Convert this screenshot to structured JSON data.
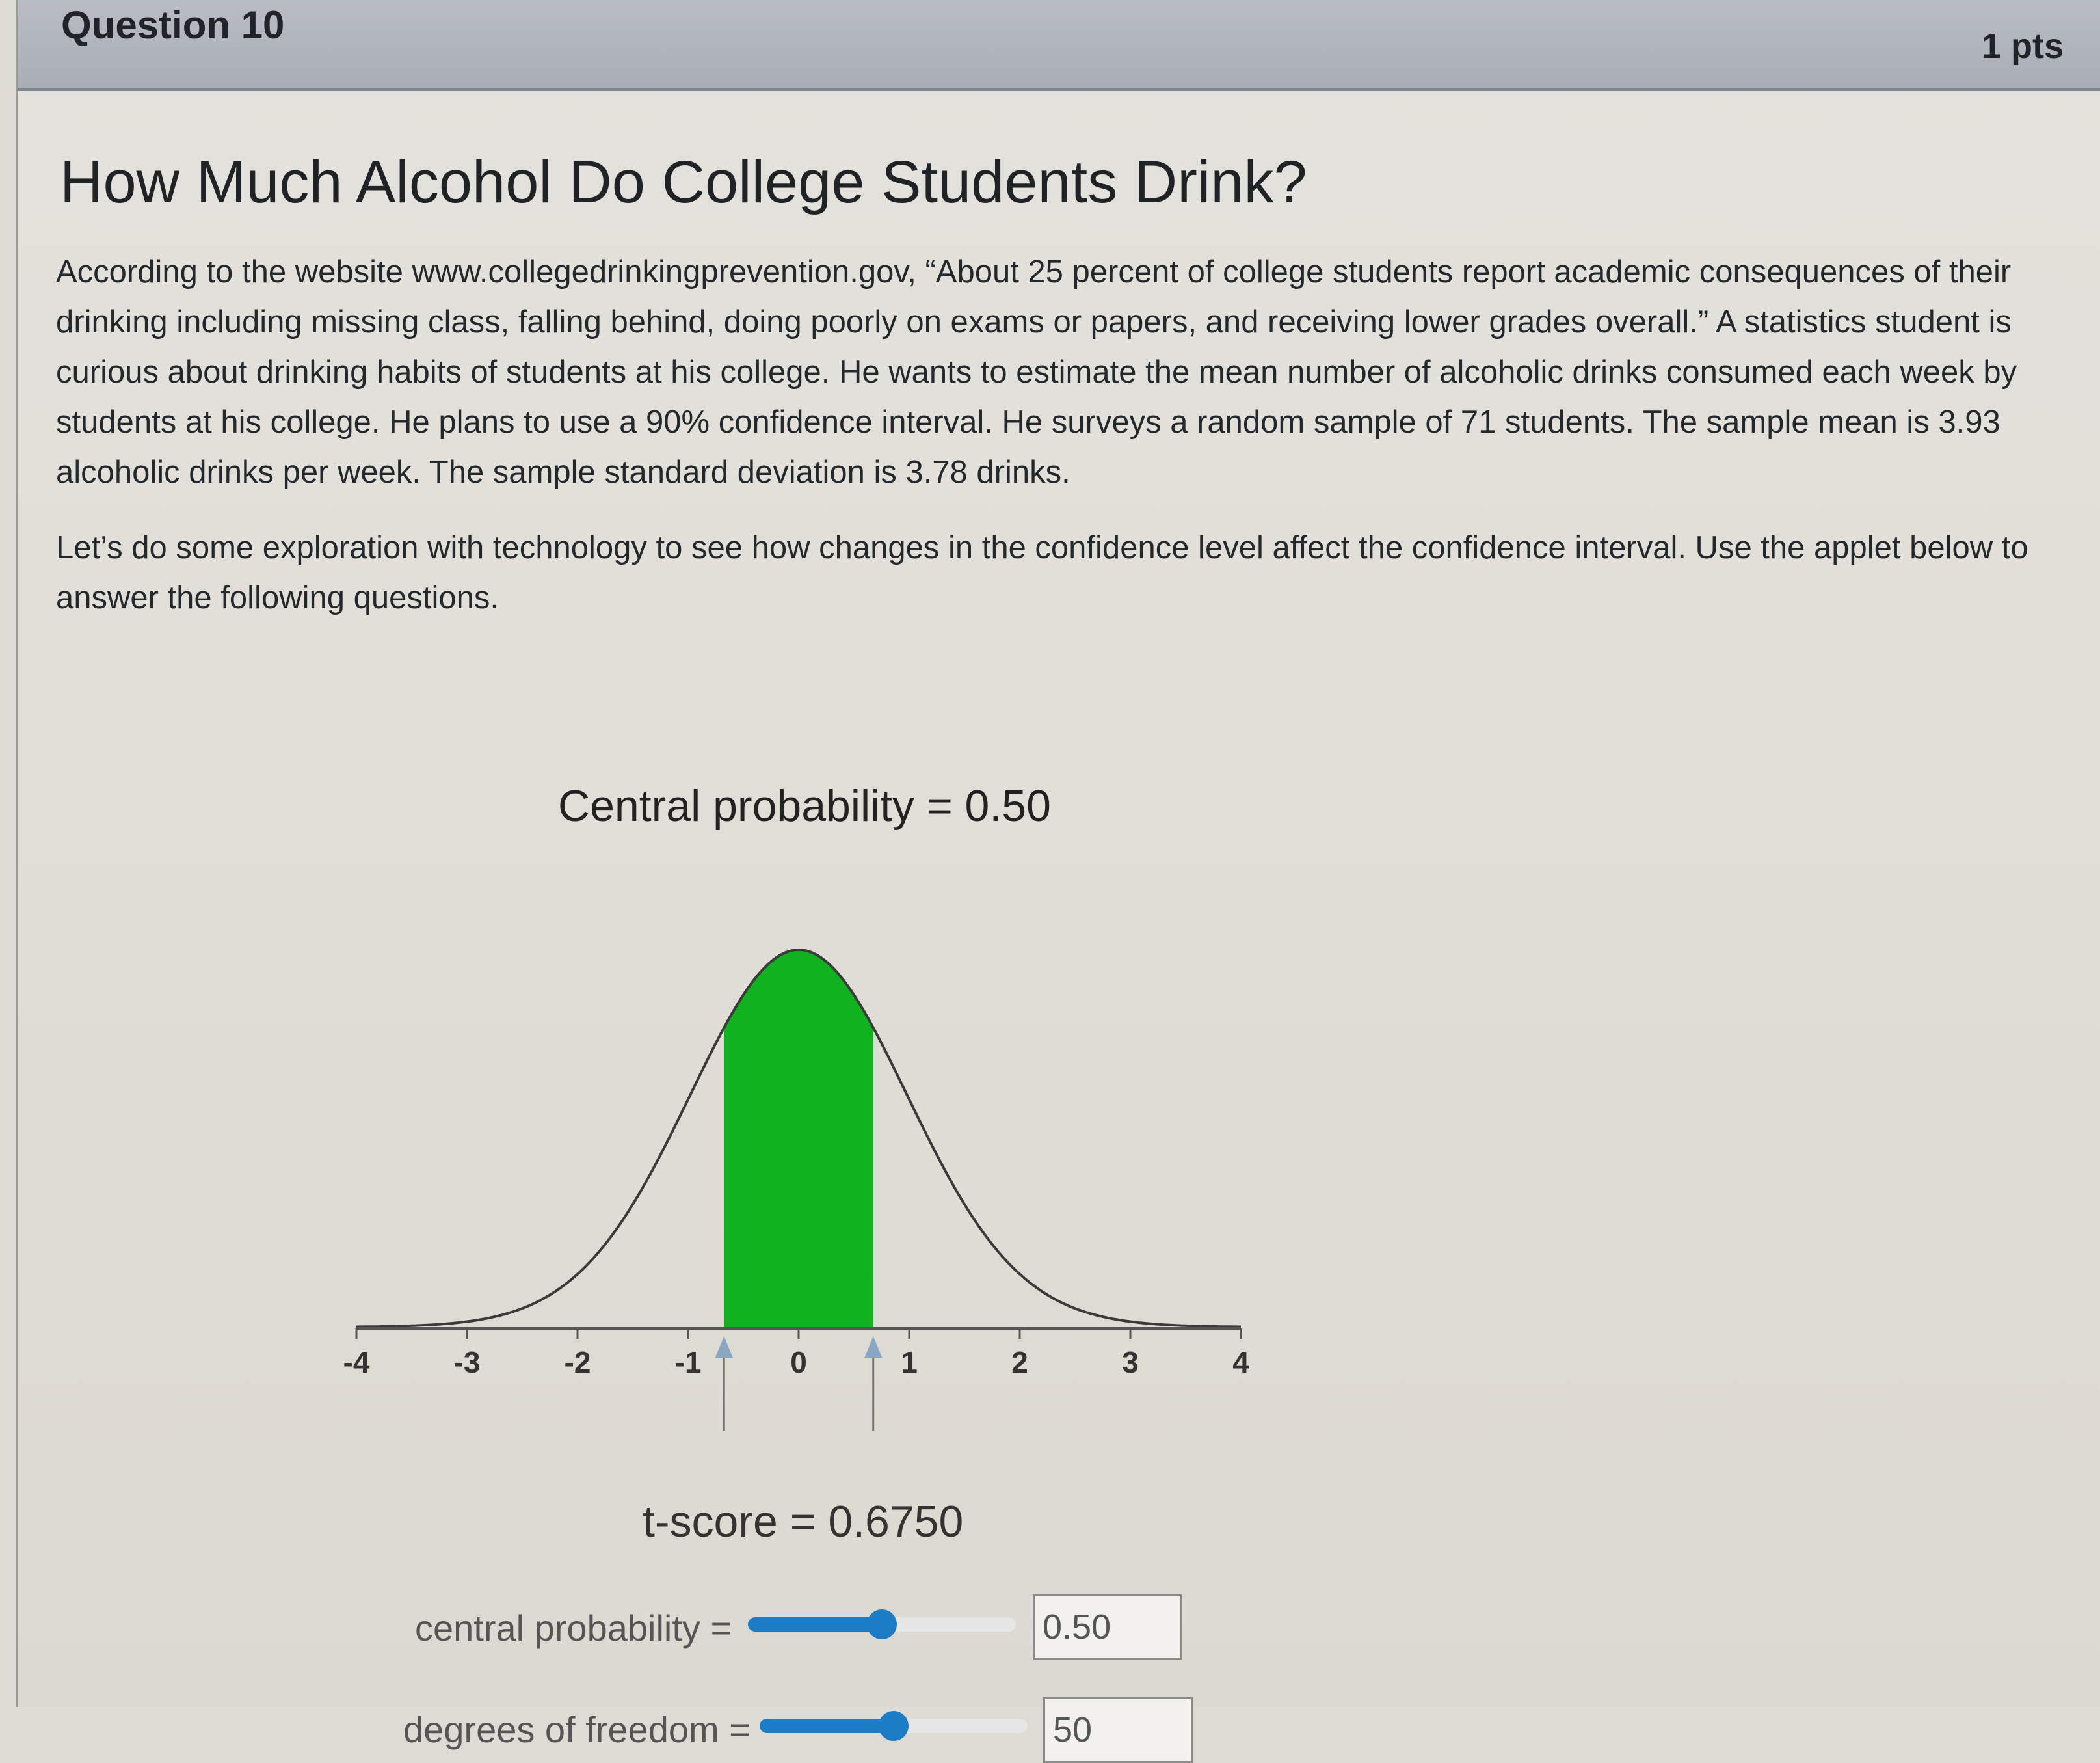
{
  "question": {
    "title": "Question 10",
    "points": "1 pts"
  },
  "page_title": "How Much Alcohol Do College Students Drink?",
  "paragraphs": [
    "According to the website www.collegedrinkingprevention.gov, “About 25 percent of college students report academic consequences of their drinking including missing class, falling behind, doing poorly on exams or papers, and receiving lower grades overall.” A statistics student is curious about drinking habits of students at his college. He wants to estimate the mean number of alcoholic drinks consumed each week by students at his college. He plans to use a 90% confidence interval. He surveys a random sample of 71 students. The sample mean is 3.93 alcoholic drinks per week. The sample standard deviation is 3.78 drinks.",
    "Let’s do some exploration with technology to see how changes in the confidence level affect the confidence interval. Use the applet below to answer the following questions."
  ],
  "applet": {
    "title": "Central probability = 0.50",
    "t_score_text": "t-score = 0.6750",
    "sliders": {
      "central_probability": {
        "label": "central probability =",
        "value": "0.50",
        "fraction": 0.5
      },
      "degrees_of_freedom": {
        "label": "degrees of freedom =",
        "value": "50",
        "fraction": 0.5
      }
    },
    "colors": {
      "shaded": "#10b21f",
      "curve": "#3a3a3a",
      "slider": "#1c7cc6"
    }
  },
  "chart_data": {
    "type": "area",
    "distribution": "t",
    "df": 50,
    "shaded_interval": [
      -0.675,
      0.675
    ],
    "xlim": [
      -4,
      4
    ],
    "xticks": [
      "-4",
      "-3",
      "-2",
      "-1",
      "0",
      "1",
      "2",
      "3",
      "4"
    ],
    "title": "Central probability = 0.50"
  }
}
